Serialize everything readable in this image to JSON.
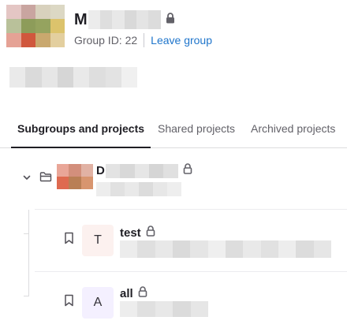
{
  "group": {
    "name_initial": "M",
    "id_text": "Group ID: 22",
    "leave_label": "Leave group",
    "visibility_icon": "lock-icon"
  },
  "colors": {
    "link": "#1f75cb",
    "tab_active": "#1f1e24",
    "text_secondary": "#626168",
    "avatar_pink_bg": "#fcf1ef",
    "avatar_lavender_bg": "#f4f0ff"
  },
  "tabs": [
    {
      "label": "Subgroups and projects",
      "active": true
    },
    {
      "label": "Shared projects",
      "active": false
    },
    {
      "label": "Archived projects",
      "active": false
    }
  ],
  "tree": {
    "subgroup": {
      "name_initial": "D",
      "expanded": true,
      "icons": [
        "chevron-down-icon",
        "folder-icon",
        "lock-icon"
      ]
    },
    "projects": [
      {
        "avatar_letter": "T",
        "name": "test",
        "icons": [
          "bookmark-icon",
          "lock-icon"
        ]
      },
      {
        "avatar_letter": "A",
        "name": "all",
        "icons": [
          "bookmark-icon",
          "lock-icon"
        ]
      }
    ]
  }
}
